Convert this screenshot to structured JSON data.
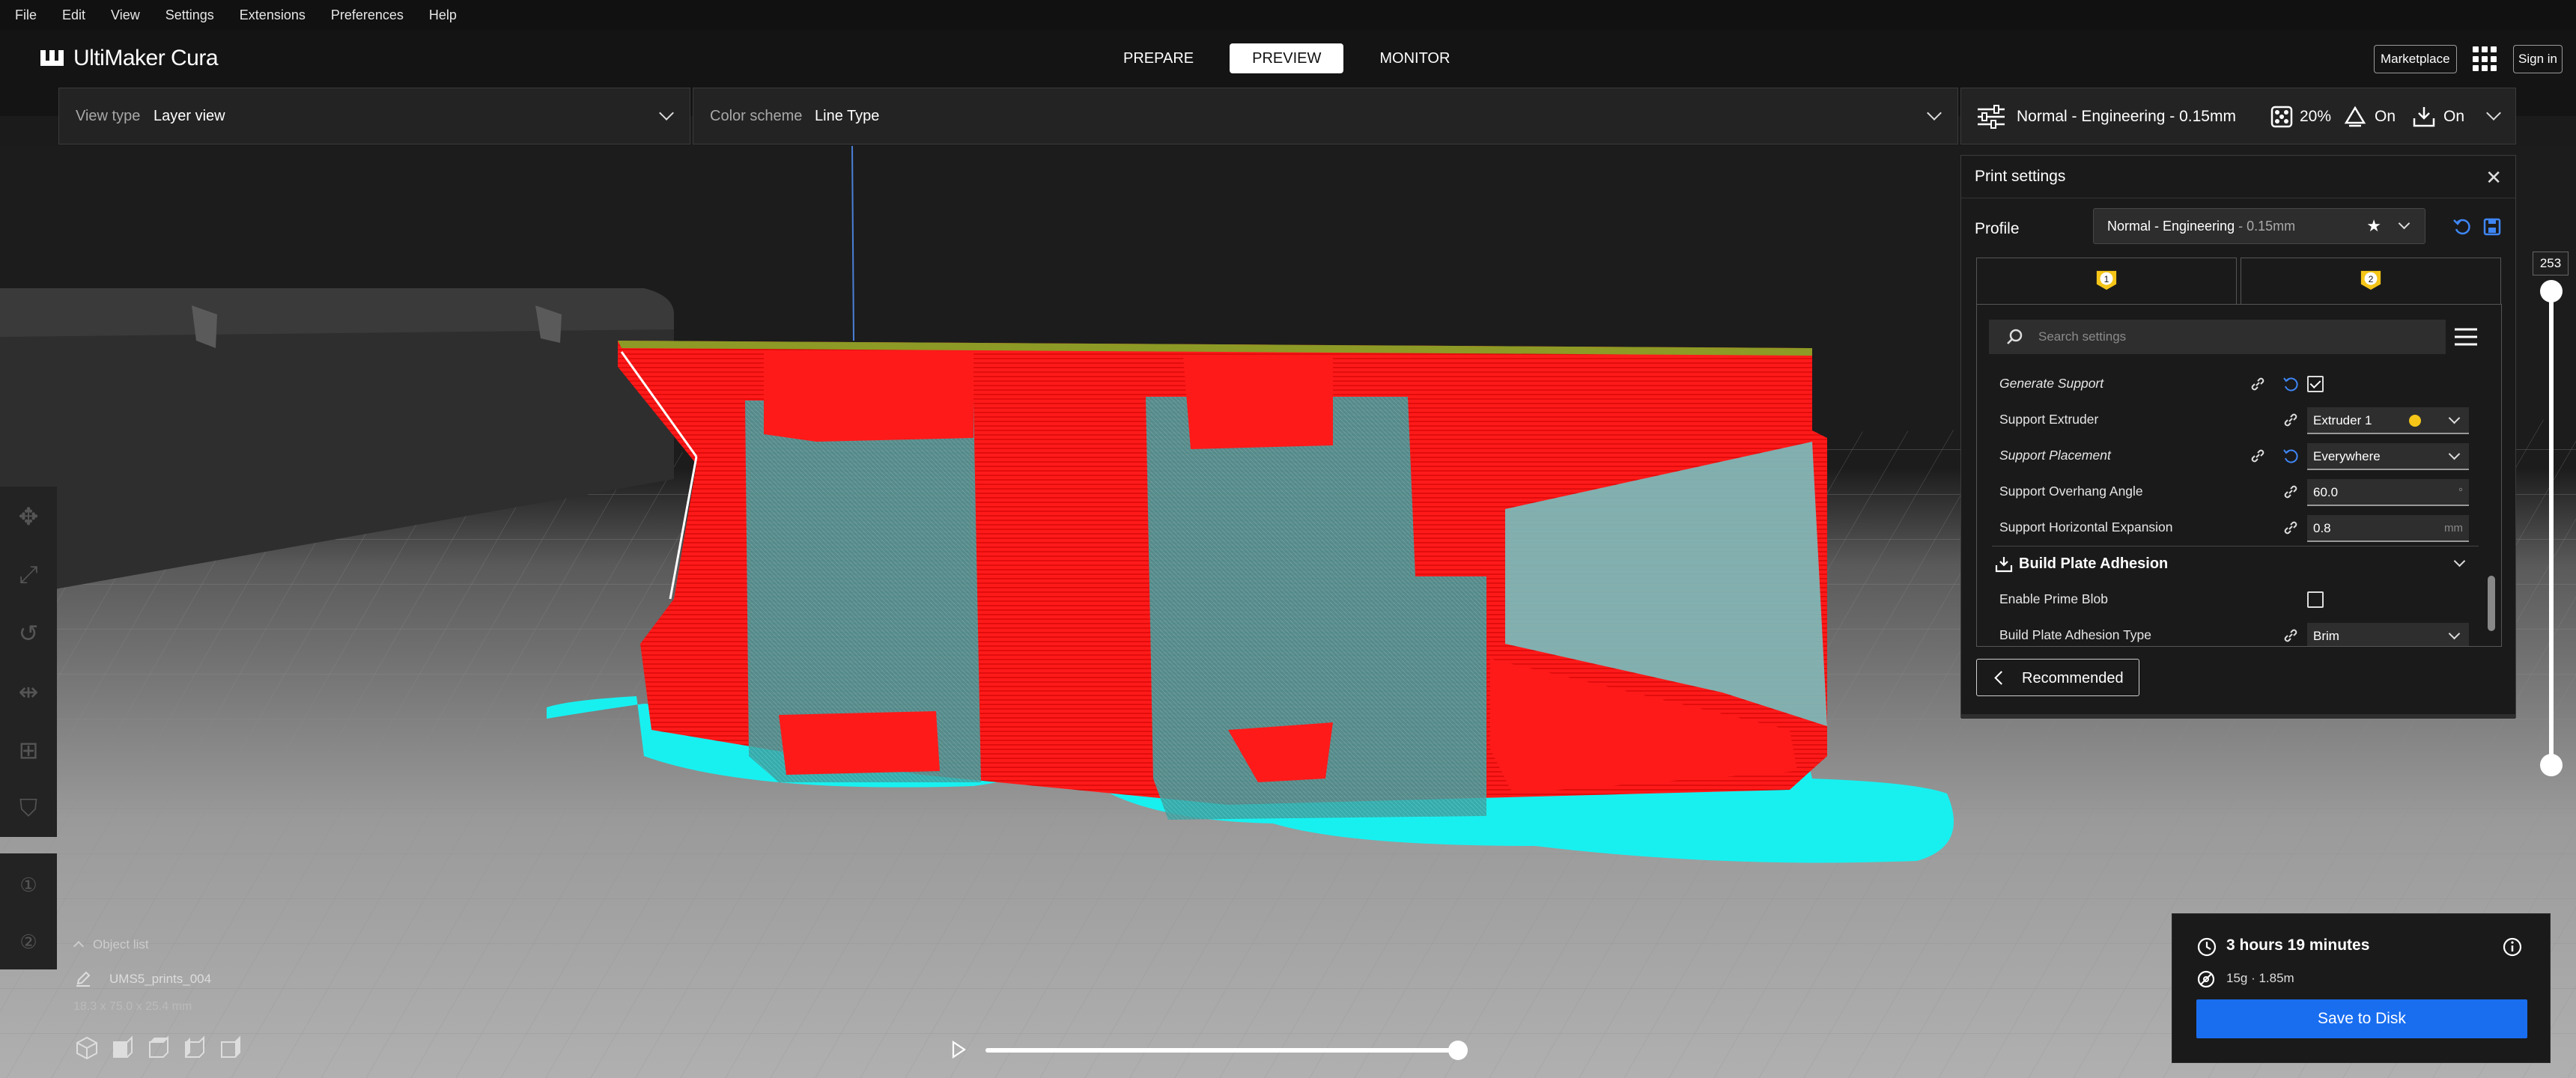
{
  "menu": [
    "File",
    "Edit",
    "View",
    "Settings",
    "Extensions",
    "Preferences",
    "Help"
  ],
  "app": {
    "logo_text": "UltiMaker Cura"
  },
  "stages": [
    "PREPARE",
    "PREVIEW",
    "MONITOR"
  ],
  "active_stage": "PREVIEW",
  "header_right": {
    "marketplace": "Marketplace",
    "signin": "Sign in"
  },
  "view_bar": {
    "view_type_label": "View type",
    "view_type_value": "Layer view",
    "color_scheme_label": "Color scheme",
    "color_scheme_value": "Line Type"
  },
  "print_bar": {
    "profile": "Normal - Engineering - 0.15mm",
    "infill": "20%",
    "support": "On",
    "adhesion": "On"
  },
  "layer_slider": {
    "current_layer": "253"
  },
  "print_settings": {
    "title": "Print settings",
    "profile_label": "Profile",
    "profile_name": "Normal - Engineering",
    "profile_suffix": " - 0.15mm",
    "extruder_tabs": [
      "1",
      "2"
    ],
    "search_placeholder": "Search settings",
    "rows": [
      {
        "label": "Generate Support",
        "italic": true,
        "type": "checkbox",
        "checked": true
      },
      {
        "label": "Support Extruder",
        "italic": false,
        "type": "dropdown",
        "value": "Extruder 1"
      },
      {
        "label": "Support Placement",
        "italic": true,
        "type": "dropdown",
        "value": "Everywhere"
      },
      {
        "label": "Support Overhang Angle",
        "italic": false,
        "type": "number",
        "value": "60.0",
        "unit": "°"
      },
      {
        "label": "Support Horizontal Expansion",
        "italic": false,
        "type": "number",
        "value": "0.8",
        "unit": "mm"
      }
    ],
    "category": "Build Plate Adhesion",
    "adhesion_rows": [
      {
        "label": "Enable Prime Blob",
        "type": "checkbox",
        "checked": false
      },
      {
        "label": "Build Plate Adhesion Type",
        "type": "dropdown",
        "value": "Brim"
      }
    ],
    "recommended_button": "Recommended"
  },
  "object_list": {
    "toggle_label": "Object list",
    "object_name": "UMS5_prints_004",
    "dimensions": "18.3 x 75.0 x 25.4 mm"
  },
  "estimate": {
    "time": "3 hours 19 minutes",
    "material": "15g · 1.85m",
    "save_button": "Save to Disk"
  },
  "colors": {
    "accent": "#196ef0",
    "extruder_yellow": "#f5c518",
    "model_red": "#ff1a1a",
    "support_cyan": "#5fd2d2",
    "brim_cyan": "#18f0f0"
  }
}
